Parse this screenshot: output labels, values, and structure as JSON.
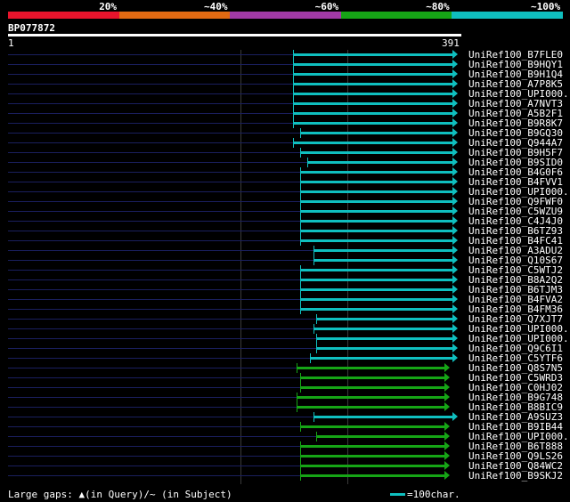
{
  "legend": [
    {
      "label": "20%",
      "color": "#e8142c"
    },
    {
      "label": "~40%",
      "color": "#e26a12"
    },
    {
      "label": "~60%",
      "color": "#a13aa6"
    },
    {
      "label": "~80%",
      "color": "#16a516"
    },
    {
      "label": "~100%",
      "color": "#0fbfbf"
    }
  ],
  "query": {
    "name": "BP077872",
    "start": "1",
    "end": "391"
  },
  "hits": [
    {
      "name": "UniRef100_B7FLE0",
      "start": 0.633,
      "color": "#0fbfbf"
    },
    {
      "name": "UniRef100_B9HQY1",
      "start": 0.633,
      "color": "#0fbfbf"
    },
    {
      "name": "UniRef100_B9H1Q4",
      "start": 0.633,
      "color": "#0fbfbf"
    },
    {
      "name": "UniRef100_A7P8K5",
      "start": 0.633,
      "color": "#0fbfbf"
    },
    {
      "name": "UniRef100_UPI000..",
      "start": 0.633,
      "color": "#0fbfbf"
    },
    {
      "name": "UniRef100_A7NVT3",
      "start": 0.633,
      "color": "#0fbfbf"
    },
    {
      "name": "UniRef100_A5B2F1",
      "start": 0.633,
      "color": "#0fbfbf"
    },
    {
      "name": "UniRef100_B9R8K7",
      "start": 0.633,
      "color": "#0fbfbf"
    },
    {
      "name": "UniRef100_B9GQ30",
      "start": 0.65,
      "color": "#0fbfbf"
    },
    {
      "name": "UniRef100_Q944A7",
      "start": 0.633,
      "color": "#0fbfbf"
    },
    {
      "name": "UniRef100_B9H5F7",
      "start": 0.65,
      "color": "#0fbfbf"
    },
    {
      "name": "UniRef100_B9SID0",
      "start": 0.665,
      "color": "#0fbfbf"
    },
    {
      "name": "UniRef100_B4G0F6",
      "start": 0.65,
      "color": "#0fbfbf"
    },
    {
      "name": "UniRef100_B4FVV1",
      "start": 0.65,
      "color": "#0fbfbf"
    },
    {
      "name": "UniRef100_UPI000..",
      "start": 0.65,
      "color": "#0fbfbf"
    },
    {
      "name": "UniRef100_Q9FWF0",
      "start": 0.65,
      "color": "#0fbfbf"
    },
    {
      "name": "UniRef100_C5WZU9",
      "start": 0.65,
      "color": "#0fbfbf"
    },
    {
      "name": "UniRef100_C4J4J0",
      "start": 0.65,
      "color": "#0fbfbf"
    },
    {
      "name": "UniRef100_B6TZ93",
      "start": 0.65,
      "color": "#0fbfbf"
    },
    {
      "name": "UniRef100_B4FC41",
      "start": 0.65,
      "color": "#0fbfbf"
    },
    {
      "name": "UniRef100_A3ADU2",
      "start": 0.679,
      "color": "#0fbfbf"
    },
    {
      "name": "UniRef100_Q10S67",
      "start": 0.679,
      "color": "#0fbfbf"
    },
    {
      "name": "UniRef100_C5WTJ2",
      "start": 0.65,
      "color": "#0fbfbf"
    },
    {
      "name": "UniRef100_B8A2Q2",
      "start": 0.65,
      "color": "#0fbfbf"
    },
    {
      "name": "UniRef100_B6TJM3",
      "start": 0.65,
      "color": "#0fbfbf"
    },
    {
      "name": "UniRef100_B4FVA2",
      "start": 0.65,
      "color": "#0fbfbf"
    },
    {
      "name": "UniRef100_B4FM36",
      "start": 0.65,
      "color": "#0fbfbf"
    },
    {
      "name": "UniRef100_Q7XJT7",
      "start": 0.685,
      "color": "#0fbfbf"
    },
    {
      "name": "UniRef100_UPI000..",
      "start": 0.679,
      "color": "#0fbfbf"
    },
    {
      "name": "UniRef100_UPI000..",
      "start": 0.685,
      "color": "#0fbfbf"
    },
    {
      "name": "UniRef100_Q9C6I1",
      "start": 0.685,
      "color": "#0fbfbf"
    },
    {
      "name": "UniRef100_C5YTF6",
      "start": 0.672,
      "color": "#0fbfbf"
    },
    {
      "name": "UniRef100_Q8S7N5",
      "start": 0.642,
      "color": "#16a516"
    },
    {
      "name": "UniRef100_C5WRD3",
      "start": 0.65,
      "color": "#16a516"
    },
    {
      "name": "UniRef100_C0HJ02",
      "start": 0.65,
      "color": "#16a516"
    },
    {
      "name": "UniRef100_B9G748",
      "start": 0.642,
      "color": "#16a516"
    },
    {
      "name": "UniRef100_B8BIC9",
      "start": 0.642,
      "color": "#16a516"
    },
    {
      "name": "UniRef100_A9SUZ3",
      "start": 0.679,
      "color": "#0fbfbf"
    },
    {
      "name": "UniRef100_B9IB44",
      "start": 0.65,
      "color": "#16a516"
    },
    {
      "name": "UniRef100_UPI000..",
      "start": 0.685,
      "color": "#16a516"
    },
    {
      "name": "UniRef100_B6T888",
      "start": 0.65,
      "color": "#16a516"
    },
    {
      "name": "UniRef100_Q9LS26",
      "start": 0.65,
      "color": "#16a516"
    },
    {
      "name": "UniRef100_Q84WC2",
      "start": 0.65,
      "color": "#16a516"
    },
    {
      "name": "UniRef100_B9SKJ2",
      "start": 0.65,
      "color": "#16a516"
    }
  ],
  "footer": {
    "gap_text": "Large gaps: ▲(in Query)/~ (in Subject)",
    "scale_text": "=100char.",
    "scale_color": "#0fbfbf"
  },
  "colors": {
    "stub": "#1a1f5e",
    "grid": "#3a3a3a"
  }
}
